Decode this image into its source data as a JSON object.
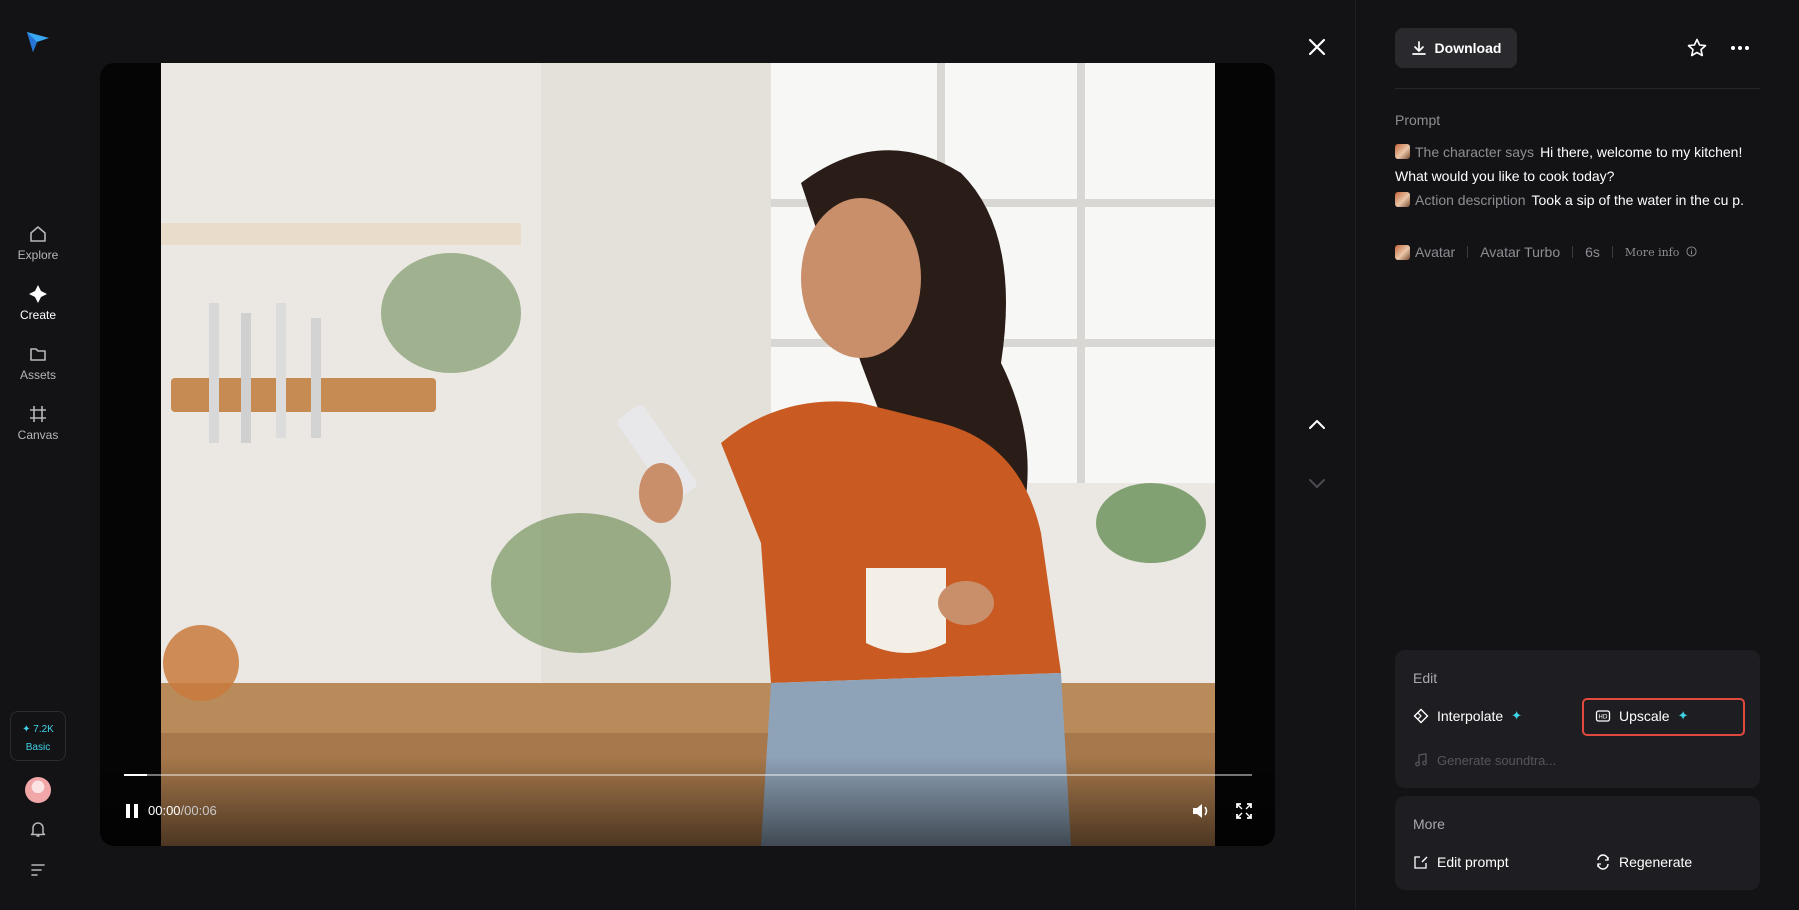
{
  "rail": {
    "nav": [
      {
        "label": "Explore",
        "icon": "home-icon"
      },
      {
        "label": "Create",
        "icon": "sparkle-icon"
      },
      {
        "label": "Assets",
        "icon": "folder-icon"
      },
      {
        "label": "Canvas",
        "icon": "canvas-icon"
      }
    ],
    "credits": {
      "amount": "✦ 7.2K",
      "plan": "Basic"
    }
  },
  "player": {
    "current_time": "00:00",
    "separator": "/",
    "duration": "00:06",
    "progress": 0.02
  },
  "panel": {
    "download_label": "Download",
    "prompt_title": "Prompt",
    "prompt_lines": [
      {
        "tag": "The character says",
        "text": "Hi there, welcome to my kitchen! What would you like to cook today?"
      },
      {
        "tag": "Action description",
        "text": "Took a sip of the water in the cu p."
      }
    ],
    "meta": {
      "type": "Avatar",
      "model": "Avatar Turbo",
      "duration": "6s",
      "more_info": "More info"
    },
    "edit": {
      "title": "Edit",
      "interpolate": "Interpolate",
      "upscale": "Upscale",
      "soundtrack": "Generate soundtra..."
    },
    "more": {
      "title": "More",
      "edit_prompt": "Edit prompt",
      "regenerate": "Regenerate"
    }
  },
  "colors": {
    "background": "#131316",
    "accent": "#3fd3e6",
    "highlight": "#e0493d",
    "card": "#1e1e22"
  }
}
